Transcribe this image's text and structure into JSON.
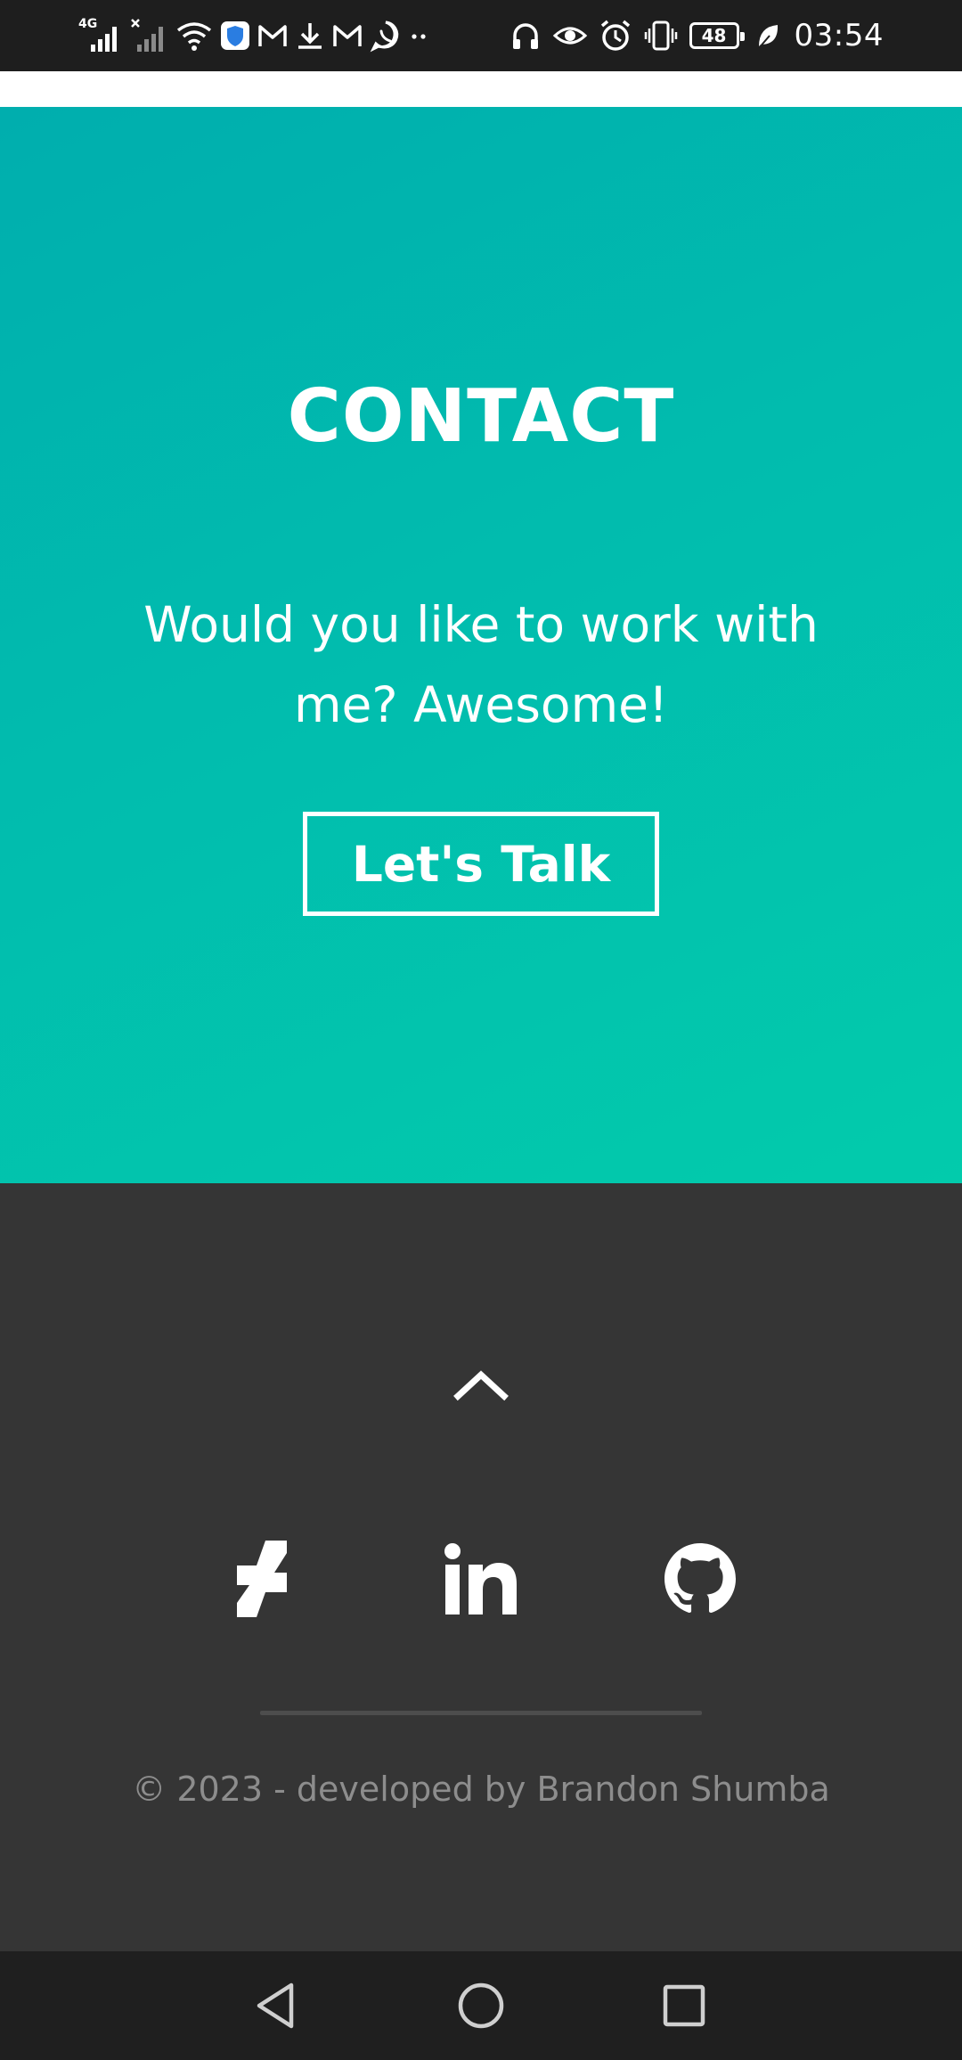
{
  "status_bar": {
    "network_label": "4G",
    "battery_level": "48",
    "time": "03:54",
    "left_icons": [
      "signal-4g-icon",
      "signal-nosim-icon",
      "wifi-icon",
      "shield-app-icon",
      "gmail-icon",
      "download-icon",
      "gmail-icon",
      "whatsapp-icon",
      "more-dots-icon"
    ],
    "right_icons": [
      "headphones-icon",
      "eye-comfort-icon",
      "alarm-icon",
      "vibrate-icon",
      "battery-icon",
      "leaf-icon"
    ]
  },
  "contact": {
    "title": "CONTACT",
    "text": "Would you like to work with me? Awesome!",
    "button_label": "Let's Talk",
    "gradient_colors": [
      "#00aeae",
      "#02cbac"
    ]
  },
  "footer": {
    "back_to_top_icon": "chevron-up-icon",
    "social_icons": [
      "deviantart-icon",
      "linkedin-icon",
      "github-icon"
    ],
    "copyright": "© 2023 - developed by Brandon Shumba",
    "background_color": "#353535"
  },
  "nav_bar": {
    "buttons": [
      "back-icon",
      "home-icon",
      "recents-icon"
    ]
  }
}
